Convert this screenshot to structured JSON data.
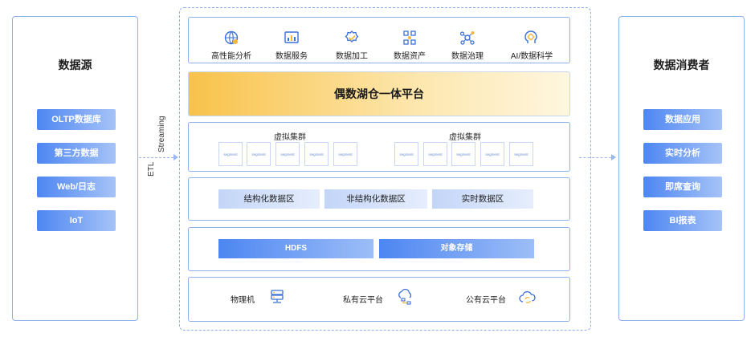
{
  "left_panel": {
    "title": "数据源",
    "items": [
      "OLTP数据库",
      "第三方数据",
      "Web/日志",
      "IoT"
    ]
  },
  "right_panel": {
    "title": "数据消费者",
    "items": [
      "数据应用",
      "实时分析",
      "即席查询",
      "BI报表"
    ]
  },
  "connector": {
    "label_etl": "ETL",
    "label_streaming": "Streaming"
  },
  "apps": [
    {
      "label": "高性能分析",
      "icon": "chart-globe-icon"
    },
    {
      "label": "数据服务",
      "icon": "bar-chart-icon"
    },
    {
      "label": "数据加工",
      "icon": "gear-check-icon"
    },
    {
      "label": "数据资产",
      "icon": "network-nodes-icon"
    },
    {
      "label": "数据治理",
      "icon": "graph-hub-icon"
    },
    {
      "label": "AI/数据科学",
      "icon": "ai-brain-icon"
    }
  ],
  "platform_title": "偶数湖仓一体平台",
  "virtual_clusters": [
    {
      "label": "虚拟集群",
      "segments": [
        "segment",
        "segment",
        "segment",
        "segment",
        "segment"
      ]
    },
    {
      "label": "虚拟集群",
      "segments": [
        "segment",
        "segment",
        "segment",
        "segment",
        "segment"
      ]
    }
  ],
  "data_zones": [
    "结构化数据区",
    "非结构化数据区",
    "实时数据区"
  ],
  "storage": [
    "HDFS",
    "对象存储"
  ],
  "infrastructure": [
    {
      "label": "物理机",
      "icon": "server-icon"
    },
    {
      "label": "私有云平台",
      "icon": "private-cloud-icon"
    },
    {
      "label": "公有云平台",
      "icon": "public-cloud-icon"
    }
  ],
  "colors": {
    "accent_blue": "#4d86f2",
    "border_blue": "#8fb0ee",
    "platform_gold": "#f8c24a"
  }
}
